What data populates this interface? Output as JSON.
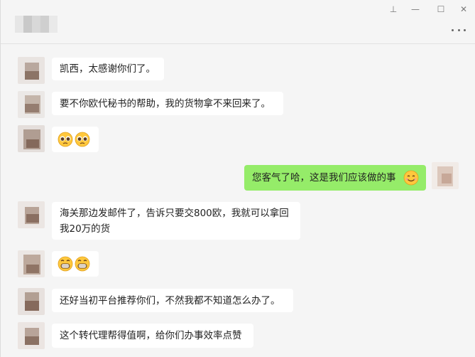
{
  "window": {
    "controls": {
      "pin": "⊥",
      "minimize": "—",
      "maximize": "☐",
      "close": "✕"
    },
    "more_icon": "more-icon"
  },
  "messages": [
    {
      "side": "left",
      "text": "凯西，太感谢你们了。"
    },
    {
      "side": "left",
      "text": "要不你欧代秘书的帮助，我的货物拿不来回来了。"
    },
    {
      "side": "left",
      "text": "",
      "emoji": [
        "pleading-face",
        "pleading-face"
      ]
    },
    {
      "side": "right",
      "text": "您客气了哈，这是我们应该做的事",
      "emoji": [
        "smiling-face"
      ]
    },
    {
      "side": "left",
      "text": "海关那边发邮件了，告诉只要交800欧，我就可以拿回我20万的货"
    },
    {
      "side": "left",
      "text": "",
      "emoji": [
        "grinning-face",
        "grinning-face"
      ]
    },
    {
      "side": "left",
      "text": "还好当初平台推荐你们，不然我都不知道怎么办了。"
    },
    {
      "side": "left",
      "text": "这个转代理帮得值啊，给你们办事效率点赞"
    }
  ],
  "colors": {
    "background": "#f5f5f5",
    "bubble_in": "#ffffff",
    "bubble_out": "#95ec69"
  }
}
